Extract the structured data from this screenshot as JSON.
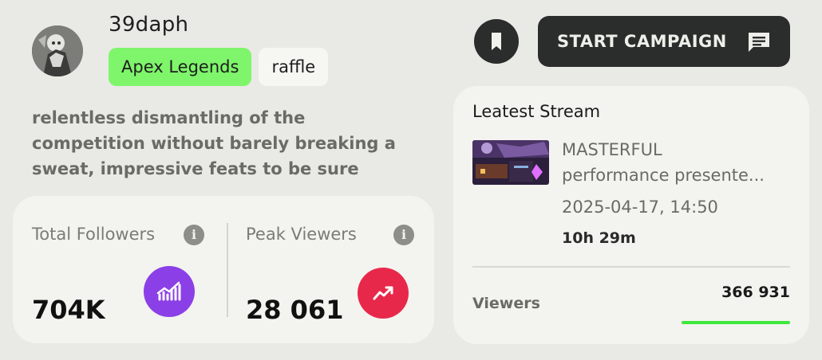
{
  "profile": {
    "username": "39daph",
    "tags": [
      "Apex Legends",
      "raffle"
    ],
    "bio": "relentless dismantling of the competition without barely breaking a sweat, impressive feats to be sure"
  },
  "stats": {
    "followers": {
      "label": "Total Followers",
      "value": "704K",
      "badge_color": "#8b3fe6",
      "icon": "chart-bars-icon"
    },
    "peak": {
      "label": "Peak Viewers",
      "value": "28 061",
      "badge_color": "#e8284a",
      "icon": "trend-up-icon"
    }
  },
  "actions": {
    "campaign_label": "START CAMPAIGN",
    "bookmark_icon": "bookmark-icon",
    "chat_icon": "chat-icon"
  },
  "latest_stream": {
    "heading": "Leatest Stream",
    "title_line1": "MASTERFUL",
    "title_line2": "performance presente...",
    "date": "2025-04-17, 14:50",
    "duration": "10h 29m",
    "viewers_label": "Viewers",
    "viewers_value": "366 931",
    "viewers_progress": 1.0,
    "accent": "#3ee83a"
  }
}
